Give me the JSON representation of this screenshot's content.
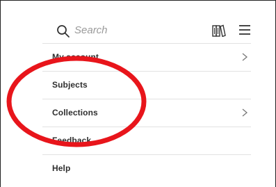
{
  "search": {
    "placeholder": "Search",
    "icon": "search-icon"
  },
  "header_icons": {
    "library": "library-books-icon",
    "menu": "hamburger-menu-icon"
  },
  "menu": {
    "items": [
      {
        "label": "My account",
        "has_chevron": true
      },
      {
        "label": "Subjects",
        "has_chevron": false
      },
      {
        "label": "Collections",
        "has_chevron": true
      },
      {
        "label": "Feedback",
        "has_chevron": false
      },
      {
        "label": "Help",
        "has_chevron": false
      }
    ]
  },
  "colors": {
    "annotation_ellipse": "#e8151b",
    "divider": "#e2e2e2",
    "placeholder": "#9a9a9a"
  }
}
